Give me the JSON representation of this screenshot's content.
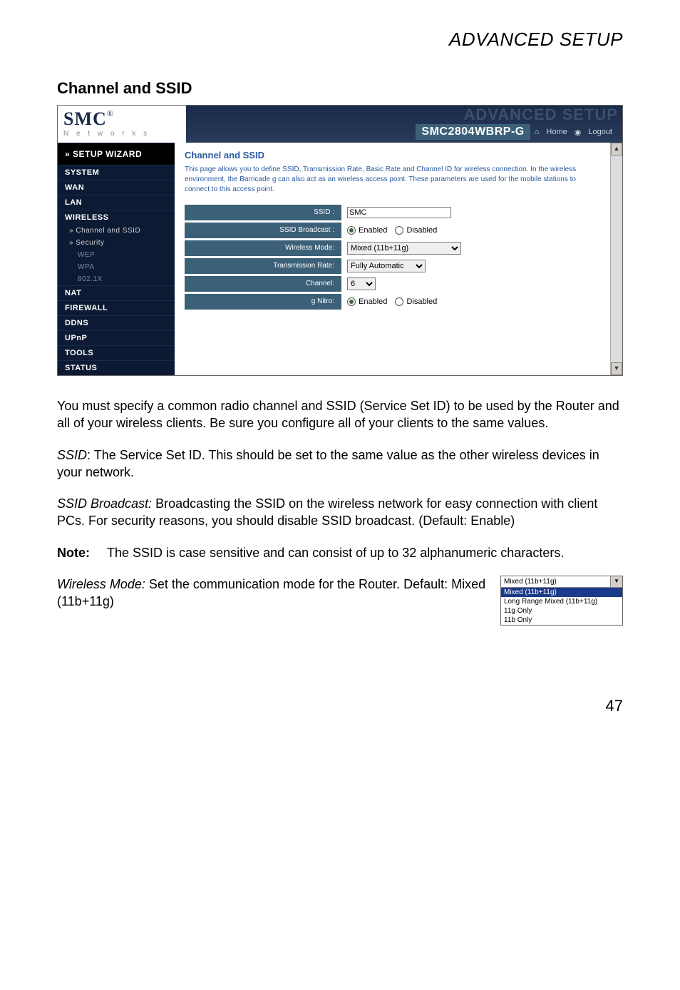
{
  "page_header": "ADVANCED SETUP",
  "section_title": "Channel and SSID",
  "screenshot": {
    "brand": "SMC",
    "brand_reg": "®",
    "brand_sub": "N e t w o r k s",
    "title_ghost": "ADVANCED SETUP",
    "model": "SMC2804WBRP-G",
    "home_link": "Home",
    "logout_link": "Logout",
    "sidebar": {
      "wizard": "» SETUP WIZARD",
      "items": [
        "SYSTEM",
        "WAN",
        "LAN",
        "WIRELESS"
      ],
      "wireless_sub": [
        "Channel and SSID",
        "Security"
      ],
      "security_sub": [
        "WEP",
        "WPA",
        "802.1X"
      ],
      "items2": [
        "NAT",
        "FIREWALL",
        "DDNS",
        "UPnP",
        "TOOLS",
        "STATUS"
      ]
    },
    "main": {
      "title": "Channel and SSID",
      "desc": "This page allows you to define SSID, Transmission Rate, Basic Rate and Channel ID for wireless connection. In the wireless environment, the Barricade g can also act as an wireless access point. These parameters are used for the mobile stations to connect to this access point.",
      "rows": {
        "ssid_label": "SSID :",
        "ssid_value": "SMC",
        "ssidb_label": "SSID Broadcast :",
        "enabled": "Enabled",
        "disabled": "Disabled",
        "wmode_label": "Wireless Mode:",
        "wmode_value": "Mixed (11b+11g)",
        "trate_label": "Transmission Rate:",
        "trate_value": "Fully Automatic",
        "channel_label": "Channel:",
        "channel_value": "6",
        "gnitro_label": "g Nitro:"
      }
    }
  },
  "para1": "You must specify a common radio channel and SSID (Service Set ID) to be used by the Router and all of your wireless clients. Be sure you configure all of your clients to the same values.",
  "ssid_term": "SSID",
  "ssid_text": ": The Service Set ID. This should be set to the same value as the other wireless devices in your network.",
  "ssidb_term": "SSID Broadcast:",
  "ssidb_text": " Broadcasting the SSID on the wireless network for easy connection with client PCs. For security reasons, you should disable SSID broadcast. (Default: Enable)",
  "note_label": "Note:",
  "note_text": "The SSID is case sensitive and can consist of up to 32 alphanumeric characters.",
  "wm_term": "Wireless Mode:",
  "wm_text": " Set the communication mode for the Router. Default: Mixed (11b+11g)",
  "dropdown": {
    "current": "Mixed (11b+11g)",
    "options": [
      "Mixed (11b+11g)",
      "Long Range Mixed (11b+11g)",
      "11g Only",
      "11b Only"
    ]
  },
  "page_num": "47"
}
